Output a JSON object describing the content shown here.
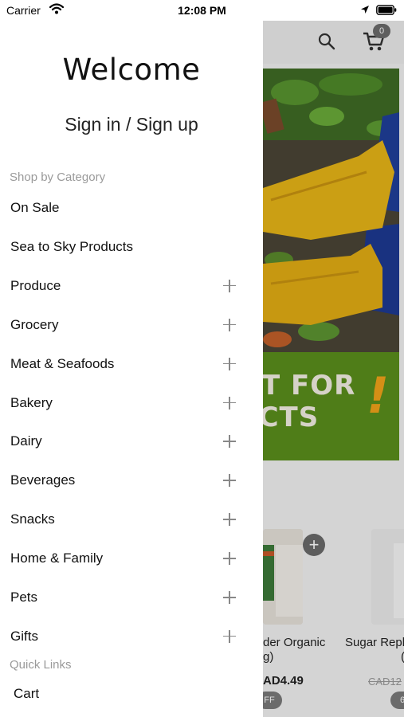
{
  "status_bar": {
    "carrier": "Carrier",
    "time": "12:08 PM"
  },
  "drawer": {
    "welcome": "Welcome",
    "sign_in": "Sign in / Sign up",
    "category_heading": "Shop by Category",
    "categories": [
      {
        "label": "On Sale",
        "expandable": false
      },
      {
        "label": "Sea to Sky Products",
        "expandable": false
      },
      {
        "label": "Produce",
        "expandable": true
      },
      {
        "label": "Grocery",
        "expandable": true
      },
      {
        "label": "Meat & Seafoods",
        "expandable": true
      },
      {
        "label": "Bakery",
        "expandable": true
      },
      {
        "label": "Dairy",
        "expandable": true
      },
      {
        "label": "Beverages",
        "expandable": true
      },
      {
        "label": "Snacks",
        "expandable": true
      },
      {
        "label": "Home & Family",
        "expandable": true
      },
      {
        "label": "Pets",
        "expandable": true
      },
      {
        "label": "Gifts",
        "expandable": true
      }
    ],
    "quick_links_heading": "Quick Links",
    "quick_links": [
      {
        "label": "Cart"
      }
    ]
  },
  "background": {
    "cart_count": "0",
    "banner_line1": "T FOR",
    "banner_line2": "UCTS",
    "banner_mark": "!",
    "products": [
      {
        "name": "der Organic",
        "sub": "g)",
        "price": "AD4.49",
        "off": "FF"
      },
      {
        "name": "Sugar Repla",
        "sub": "(",
        "old_price": "CAD12",
        "off": "6"
      }
    ]
  },
  "colors": {
    "banner_green": "#5a8f1c",
    "banner_accent": "#f2a31a",
    "boot_yellow": "#e8b617"
  }
}
